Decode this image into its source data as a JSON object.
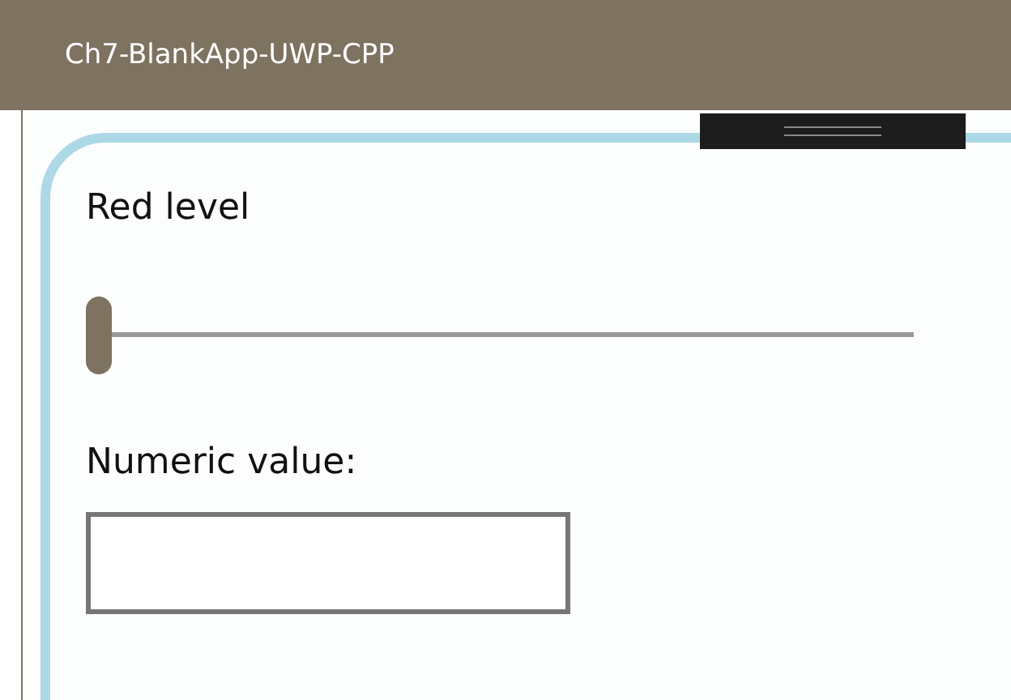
{
  "window": {
    "title": "Ch7-BlankApp-UWP-CPP"
  },
  "slider": {
    "label": "Red level",
    "level": 0
  },
  "numeric": {
    "label": "Numeric value:"
  }
}
